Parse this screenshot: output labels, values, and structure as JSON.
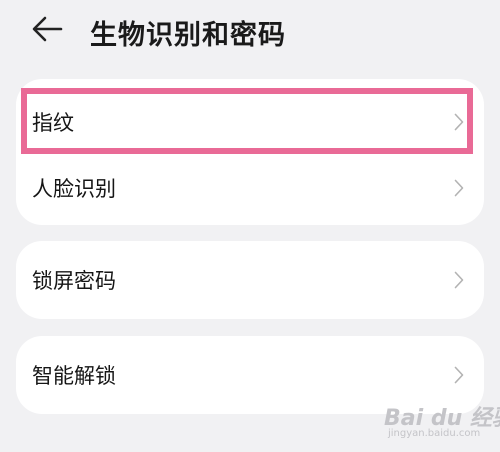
{
  "header": {
    "title": "生物识别和密码",
    "back_icon": "arrow-left-icon"
  },
  "groups": [
    {
      "items": [
        {
          "label": "指纹",
          "icon": "chevron-right-icon",
          "highlighted": true
        },
        {
          "label": "人脸识别",
          "icon": "chevron-right-icon"
        }
      ]
    },
    {
      "items": [
        {
          "label": "锁屏密码",
          "icon": "chevron-right-icon"
        }
      ]
    },
    {
      "items": [
        {
          "label": "智能解锁",
          "icon": "chevron-right-icon"
        }
      ]
    }
  ],
  "highlight_color": "#e96a96",
  "watermark": {
    "brand": "Bai du 经验",
    "url": "jingyan.baidu.com"
  }
}
